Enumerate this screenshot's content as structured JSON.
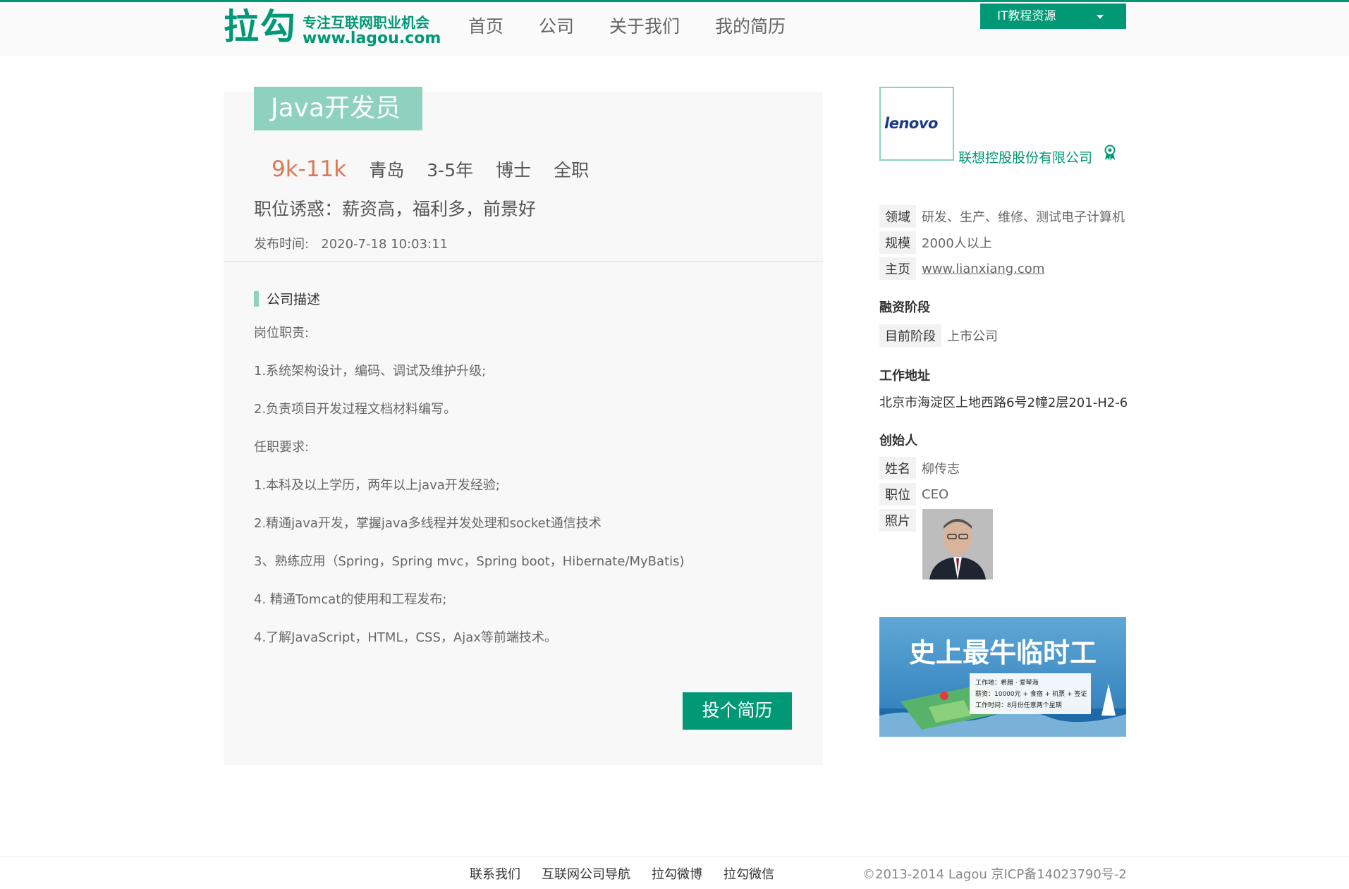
{
  "header": {
    "logo_text": "拉勾",
    "logo_slogan": "专注互联网职业机会",
    "logo_domain": "www.lagou.com",
    "nav": [
      "首页",
      "公司",
      "关于我们",
      "我的简历"
    ],
    "dropdown_label": "IT教程资源"
  },
  "job": {
    "title": "Java开发员",
    "salary": "9k-11k",
    "city": "青岛",
    "experience": "3-5年",
    "education": "博士",
    "type": "全职",
    "lure": "职位诱惑：薪资高，福利多，前景好",
    "publish_label": "发布时间:",
    "publish_time": "2020-7-18 10:03:11",
    "section_title": "公司描述",
    "description": [
      "岗位职责:",
      "1.系统架构设计，编码、调试及维护升级;",
      "2.负责项目开发过程文档材料编写。",
      "任职要求:",
      "1.本科及以上学历，两年以上java开发经验;",
      "2.精通java开发，掌握java多线程并发处理和socket通信技术",
      "3、熟练应用（Spring，Spring mvc，Spring boot，Hibernate/MyBatis)",
      "4. 精通Tomcat的使用和工程发布;",
      "4.了解JavaScript，HTML，CSS，Ajax等前端技术。"
    ],
    "apply_button": "投个简历"
  },
  "company": {
    "logo_text": "lenovo",
    "name": "联想控股股份有限公司",
    "field_label": "领域",
    "field_value": "研发、生产、维修、测试电子计算机",
    "scale_label": "规模",
    "scale_value": "2000人以上",
    "home_label": "主页",
    "home_value": "www.lianxiang.com",
    "finance_heading": "融资阶段",
    "stage_label": "目前阶段",
    "stage_value": "上市公司",
    "address_heading": "工作地址",
    "address": "北京市海淀区上地西路6号2幢2层201-H2-6",
    "founder_heading": "创始人",
    "founder_name_label": "姓名",
    "founder_name": "柳传志",
    "founder_title_label": "职位",
    "founder_title": "CEO",
    "founder_photo_label": "照片"
  },
  "banner": {
    "headline": "史上最牛临时工",
    "line1": "工作地：希腊 · 爱琴海",
    "line2": "薪资：10000元 + 食宿 + 机票 + 签证",
    "line3": "工作时间：8月份任意两个星期"
  },
  "footer": {
    "links": [
      "联系我们",
      "互联网公司导航",
      "拉勾微博",
      "拉勾微信"
    ],
    "copyright": "©2013-2014 Lagou  京ICP备14023790号-2"
  },
  "colors": {
    "brand": "#019875",
    "tag": "#8ed1bf",
    "salary": "#dd7855"
  }
}
